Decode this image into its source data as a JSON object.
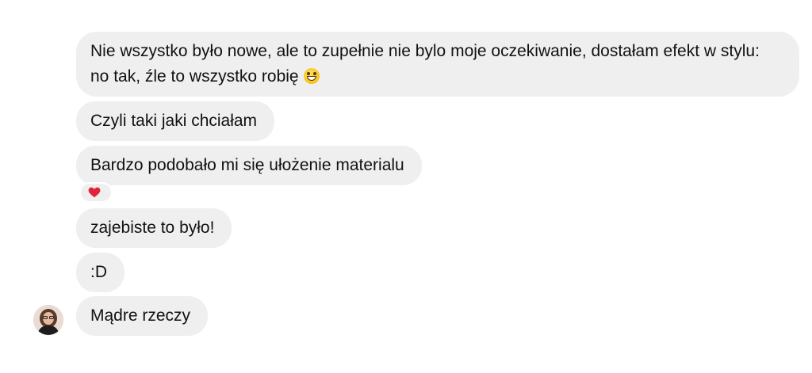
{
  "messages": [
    {
      "text": "Nie wszystko było nowe, ale to zupełnie nie bylo moje oczekiwanie, dostałam efekt w stylu: no tak, źle to wszystko robię",
      "emoji": "grinning-face-emoji"
    },
    {
      "text": "Czyli taki jaki chciałam"
    },
    {
      "text": "Bardzo podobało mi się ułożenie materialu",
      "reaction": "red-heart-icon"
    },
    {
      "text": "zajebiste to było!"
    },
    {
      "text": ":D"
    },
    {
      "text": "Mądre rzeczy"
    }
  ],
  "colors": {
    "bubble_bg": "#efefef",
    "text": "#111111",
    "reaction_heart": "#e0243b"
  }
}
